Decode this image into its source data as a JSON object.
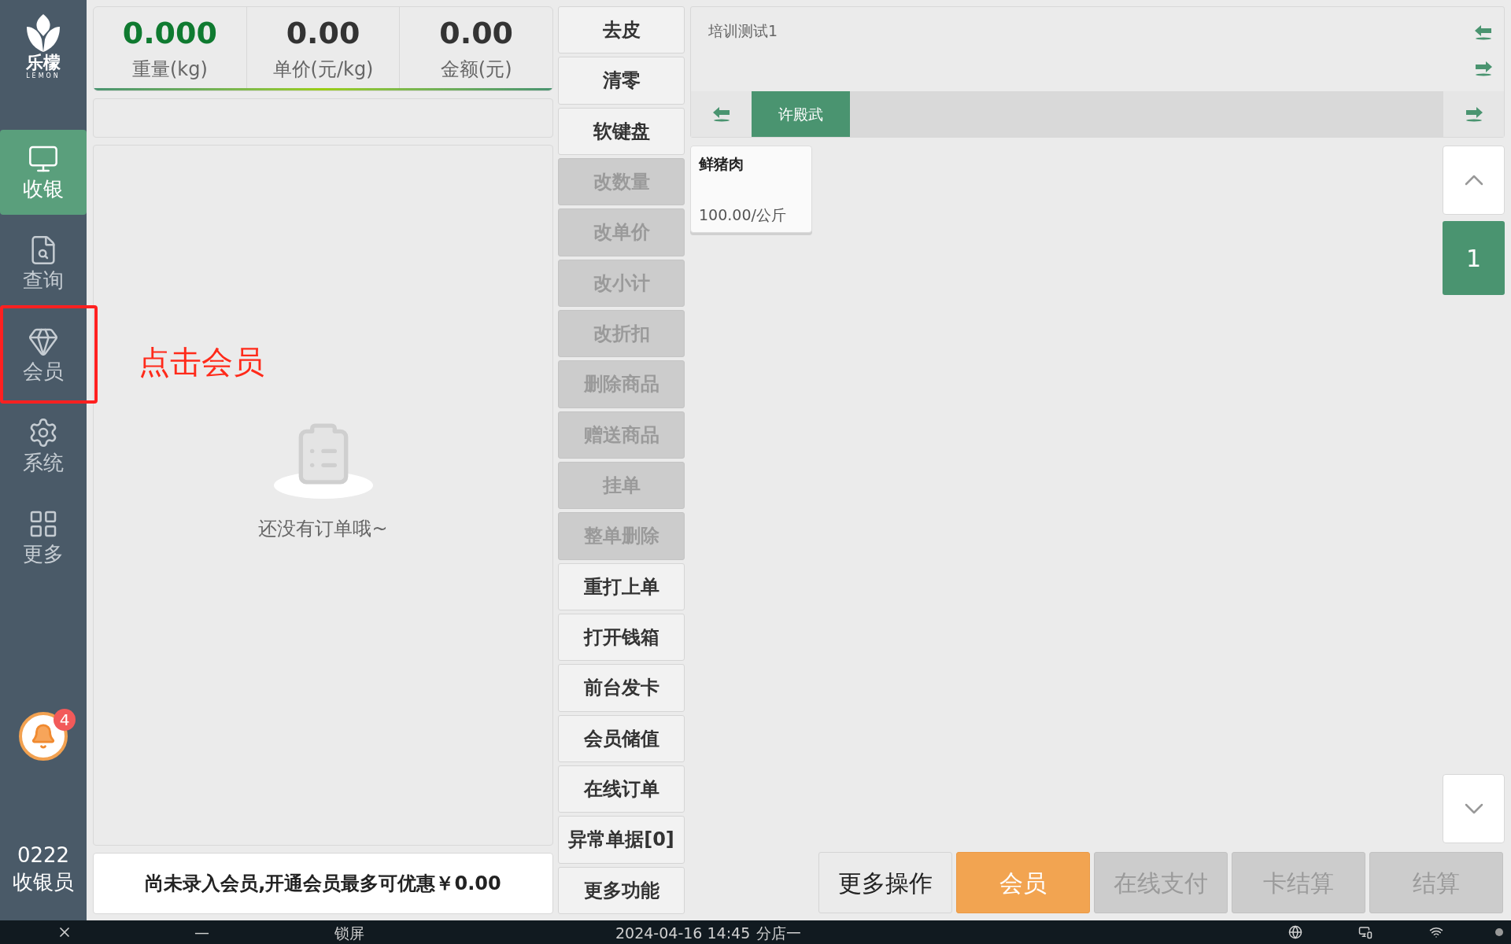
{
  "sidebar": {
    "logo": {
      "name": "乐檬",
      "subtitle": "LEMON"
    },
    "items": [
      {
        "label": "收银",
        "kind": "cashier",
        "selected": true
      },
      {
        "label": "查询",
        "kind": "query",
        "selected": false
      },
      {
        "label": "会员",
        "kind": "member",
        "selected": false
      },
      {
        "label": "系统",
        "kind": "system",
        "selected": false
      },
      {
        "label": "更多",
        "kind": "more",
        "selected": false
      }
    ],
    "notifications": {
      "count": "4"
    },
    "user": {
      "id": "0222",
      "role": "收银员"
    }
  },
  "scale": [
    {
      "value": "0.000",
      "label": "重量(kg)",
      "kind": "weight"
    },
    {
      "value": "0.00",
      "label": "单价(元/kg)",
      "kind": "plain"
    },
    {
      "value": "0.00",
      "label": "金额(元)",
      "kind": "plain"
    }
  ],
  "order_list": {
    "empty_text": "还没有订单哦~"
  },
  "member_bar": {
    "text": "尚未录入会员,开通会员最多可优惠￥0.00"
  },
  "function_buttons": [
    {
      "label": "去皮",
      "disabled": false
    },
    {
      "label": "清零",
      "disabled": false
    },
    {
      "label": "软键盘",
      "disabled": false
    },
    {
      "label": "改数量",
      "disabled": true
    },
    {
      "label": "改单价",
      "disabled": true
    },
    {
      "label": "改小计",
      "disabled": true
    },
    {
      "label": "改折扣",
      "disabled": true
    },
    {
      "label": "删除商品",
      "disabled": true
    },
    {
      "label": "赠送商品",
      "disabled": true
    },
    {
      "label": "挂单",
      "disabled": true
    },
    {
      "label": "整单删除",
      "disabled": true
    },
    {
      "label": "重打上单",
      "disabled": false
    },
    {
      "label": "打开钱箱",
      "disabled": false
    },
    {
      "label": "前台发卡",
      "disabled": false
    },
    {
      "label": "会员储值",
      "disabled": false
    },
    {
      "label": "在线订单",
      "disabled": false
    },
    {
      "label": "异常单据[0]",
      "disabled": false
    },
    {
      "label": "更多功能",
      "disabled": false
    }
  ],
  "category_panel": {
    "title": "培训测试1",
    "tabs": [
      {
        "label": "许殿武",
        "selected": true
      }
    ]
  },
  "products": [
    {
      "name": "鲜猪肉",
      "price": "100.00/公斤"
    }
  ],
  "pager": {
    "pages": [
      {
        "label": "1",
        "selected": true
      }
    ]
  },
  "action_buttons": [
    {
      "label": "更多操作",
      "kind": "default"
    },
    {
      "label": "会员",
      "kind": "primary"
    },
    {
      "label": "在线支付",
      "kind": "disabled"
    },
    {
      "label": "卡结算",
      "kind": "disabled"
    },
    {
      "label": "结算",
      "kind": "disabled"
    }
  ],
  "annotation": {
    "text": "点击会员"
  },
  "taskbar": {
    "minimize": "—",
    "lock": "锁屏",
    "datetime": "2024-04-16 14:45",
    "store": "分店一"
  }
}
